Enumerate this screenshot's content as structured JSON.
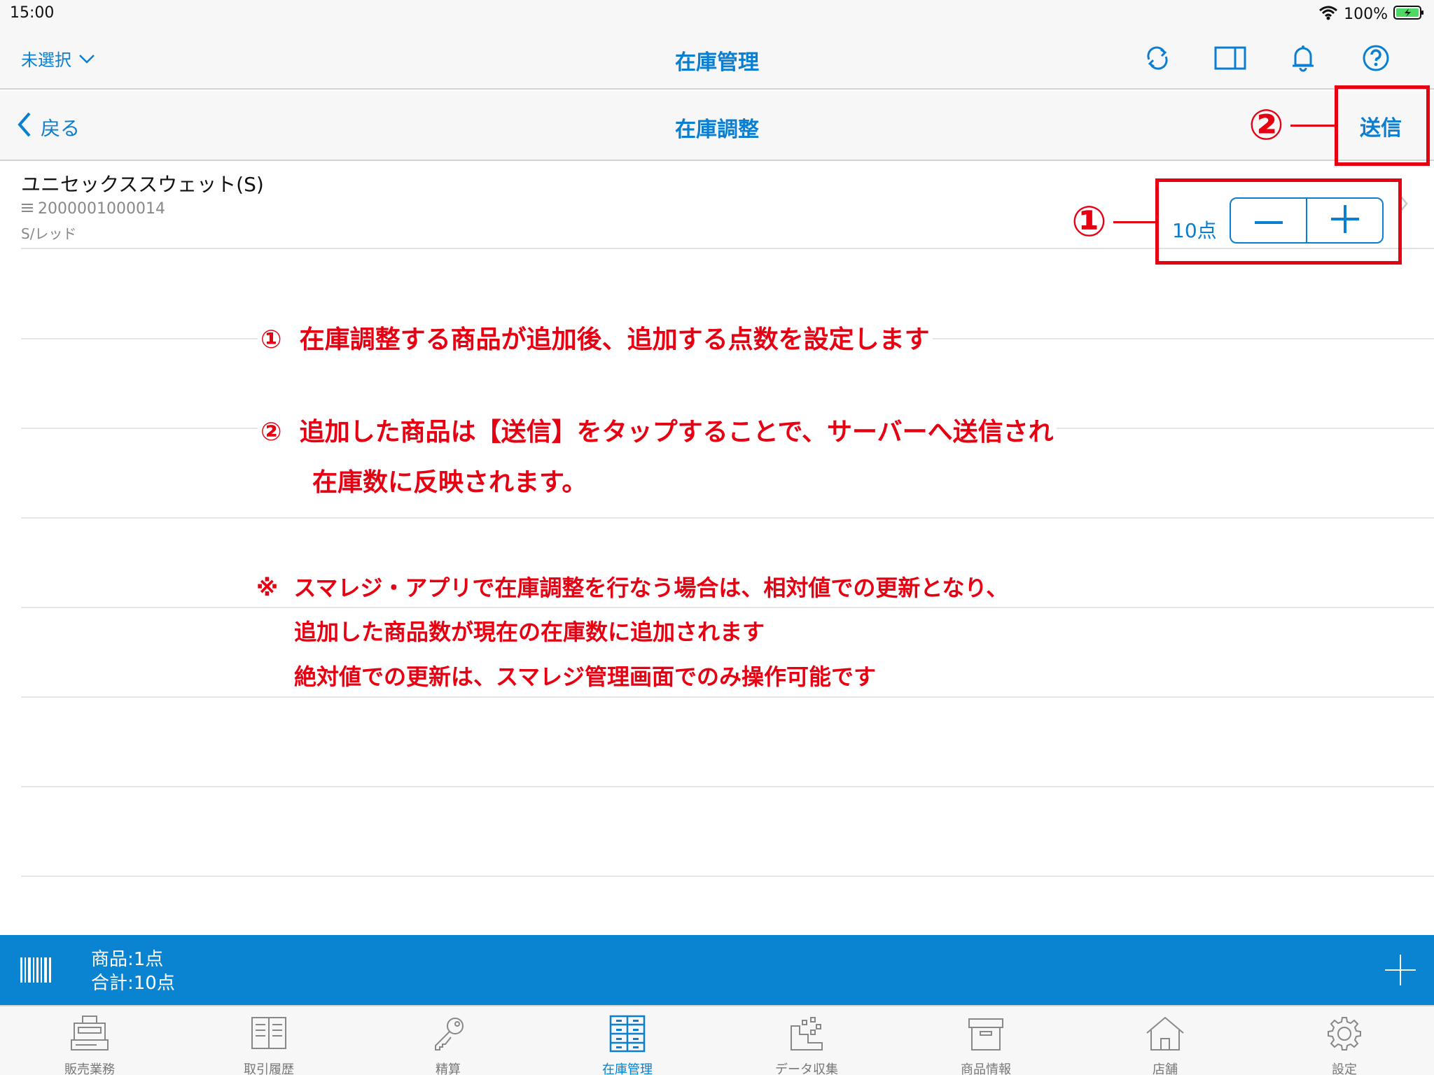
{
  "status_bar": {
    "time": "15:00",
    "battery": "100%"
  },
  "nav": {
    "store_select": "未選択",
    "title": "在庫管理",
    "icons": [
      "refresh-icon",
      "split-view-icon",
      "bell-icon",
      "help-icon"
    ]
  },
  "subnav": {
    "back_label": "戻る",
    "title": "在庫調整",
    "send_label": "送信"
  },
  "product": {
    "name": "ユニセックススウェット(S)",
    "code": "2000001000014",
    "variant": "S/レッド",
    "quantity": "10点"
  },
  "annotations": {
    "marker1": "①",
    "marker2": "②",
    "line1_num": "①",
    "line1": "在庫調整する商品が追加後、追加する点数を設定します",
    "line2_num": "②",
    "line2a": "追加した商品は【送信】をタップすることで、サーバーへ送信され",
    "line2b": "在庫数に反映されます。",
    "note_mark": "※",
    "note1": "スマレジ・アプリで在庫調整を行なう場合は、相対値での更新となり、",
    "note2": "追加した商品数が現在の在庫数に追加されます",
    "note3": "絶対値での更新は、スマレジ管理画面でのみ操作可能です"
  },
  "summary": {
    "items": "商品:1点",
    "total": "合計:10点"
  },
  "tabs": [
    {
      "label": "販売業務",
      "icon": "register-icon",
      "active": false
    },
    {
      "label": "取引履歴",
      "icon": "book-icon",
      "active": false
    },
    {
      "label": "精算",
      "icon": "key-icon",
      "active": false
    },
    {
      "label": "在庫管理",
      "icon": "inventory-icon",
      "active": true
    },
    {
      "label": "データ収集",
      "icon": "data-icon",
      "active": false
    },
    {
      "label": "商品情報",
      "icon": "box-icon",
      "active": false
    },
    {
      "label": "店舗",
      "icon": "store-icon",
      "active": false
    },
    {
      "label": "設定",
      "icon": "gear-icon",
      "active": false
    }
  ],
  "colors": {
    "accent": "#0a7ed1",
    "summary_bar": "#0a84d0",
    "annotation": "#e60012"
  }
}
